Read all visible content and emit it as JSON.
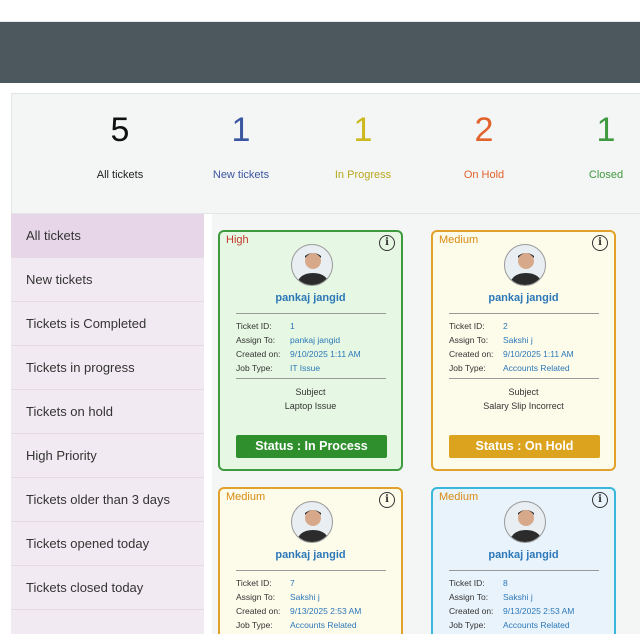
{
  "stats": [
    {
      "count": "5",
      "label": "All tickets",
      "color": "#111111",
      "label_color": "#222222"
    },
    {
      "count": "1",
      "label": "New tickets",
      "color": "#3a56a0",
      "label_color": "#3a56a0"
    },
    {
      "count": "1",
      "label": "In Progress",
      "color": "#cdb81e",
      "label_color": "#b9a71c"
    },
    {
      "count": "2",
      "label": "On Hold",
      "color": "#e2622b",
      "label_color": "#e2622b"
    },
    {
      "count": "1",
      "label": "Closed",
      "color": "#3f9a3f",
      "label_color": "#3f9a3f"
    }
  ],
  "sidebar": {
    "items": [
      {
        "label": "All tickets",
        "active": true
      },
      {
        "label": "New tickets"
      },
      {
        "label": "Tickets is Completed"
      },
      {
        "label": "Tickets in progress"
      },
      {
        "label": "Tickets on hold"
      },
      {
        "label": "High Priority"
      },
      {
        "label": "Tickets older than 3 days"
      },
      {
        "label": "Tickets opened today"
      },
      {
        "label": "Tickets closed today"
      }
    ]
  },
  "field_labels": {
    "ticket_id": "Ticket ID:",
    "assign_to": "Assign To:",
    "created_on": "Created on:",
    "job_type": "Job Type:",
    "subject": "Subject"
  },
  "tickets": [
    {
      "priority": "High",
      "priority_color": "#c0392b",
      "name": "pankaj jangid",
      "id": "1",
      "assign_to": "pankaj jangid",
      "created_on": "9/10/2025 1:11 AM",
      "job_type": "IT Issue",
      "subject": "Laptop Issue",
      "status": "Status : In Process",
      "border": "#3e9a3e",
      "bg": "#e6f8e3",
      "status_bg": "#2f8f2c"
    },
    {
      "priority": "Medium",
      "priority_color": "#d88a12",
      "name": "pankaj jangid",
      "id": "2",
      "assign_to": "Sakshi j",
      "created_on": "9/10/2025 1:11 AM",
      "job_type": "Accounts Related",
      "subject": "Salary Slip Incorrect",
      "status": "Status : On Hold",
      "border": "#e2a12b",
      "bg": "#fdfbea",
      "status_bg": "#dca31f"
    },
    {
      "priority": "Medium",
      "priority_color": "#d88a12",
      "name": "pankaj jangid",
      "id": "7",
      "assign_to": "Sakshi j",
      "created_on": "9/13/2025 2:53 AM",
      "job_type": "Accounts Related",
      "border": "#e2a12b",
      "bg": "#fdfbea"
    },
    {
      "priority": "Medium",
      "priority_color": "#d88a12",
      "name": "pankaj jangid",
      "id": "8",
      "assign_to": "Sakshi j",
      "created_on": "9/13/2025 2:53 AM",
      "job_type": "Accounts Related",
      "border": "#39b8dc",
      "bg": "#e9f3fb"
    }
  ]
}
